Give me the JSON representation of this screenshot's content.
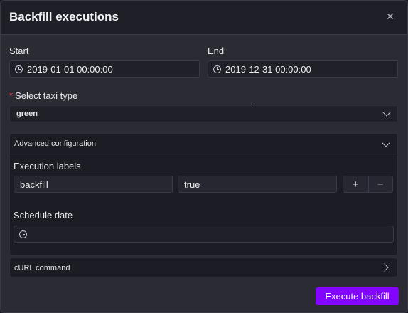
{
  "dialog": {
    "title": "Backfill executions",
    "close_icon": "close-icon"
  },
  "start": {
    "label": "Start",
    "value": "2019-01-01 00:00:00"
  },
  "end": {
    "label": "End",
    "value": "2019-12-31 00:00:00"
  },
  "taxi_type": {
    "required_marker": "*",
    "label": "Select taxi type",
    "value": "green"
  },
  "advanced": {
    "title": "Advanced configuration",
    "execution_labels": {
      "label": "Execution labels",
      "key": "backfill",
      "value": "true",
      "add": "+",
      "remove": "−"
    },
    "schedule_date": {
      "label": "Schedule date",
      "value": ""
    }
  },
  "curl": {
    "title": "cURL command"
  },
  "footer": {
    "execute_label": "Execute backfill"
  },
  "colors": {
    "accent": "#8405ff",
    "required": "#e5484d"
  }
}
